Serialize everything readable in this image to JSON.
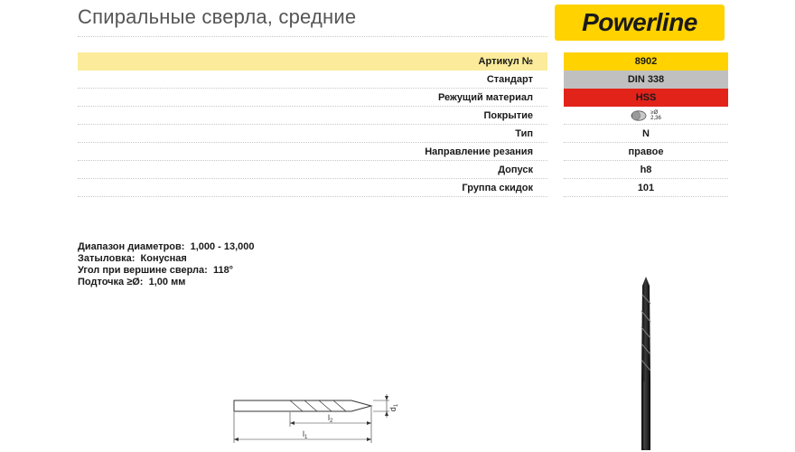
{
  "header": {
    "title": "Спиральные сверла, средние",
    "brand": "Powerline",
    "brand_color": "#ffd200"
  },
  "spec_table": [
    {
      "label": "Артикул №",
      "value": "8902",
      "color": "#ffd200"
    },
    {
      "label": "Стандарт",
      "value": "DIN 338",
      "color": "#c0c0c0"
    },
    {
      "label": "Режущий материал",
      "value": "HSS",
      "color": "#e2231a"
    },
    {
      "label": "Покрытие",
      "value": "",
      "coating_line1": "≥Ø",
      "coating_line2": "2,36"
    },
    {
      "label": "Тип",
      "value": "N"
    },
    {
      "label": "Направление резания",
      "value": "правое"
    },
    {
      "label": "Допуск",
      "value": "h8"
    },
    {
      "label": "Группа скидок",
      "value": "101"
    }
  ],
  "properties": [
    {
      "label": "Диапазон диаметров:",
      "value": "1,000 - 13,000"
    },
    {
      "label": "Затыловка:",
      "value": "Конусная"
    },
    {
      "label": "Угол при вершине сверла:",
      "value": "118°"
    },
    {
      "label": "Подточка ≥Ø:",
      "value": "1,00 мм"
    }
  ],
  "drawing": {
    "d1": "d",
    "d1_sub": "1",
    "l2": "l",
    "l2_sub": "2",
    "l1": "l",
    "l1_sub": "1"
  },
  "icons": {
    "logo": "powerline-logo",
    "coating": "coating-icon",
    "drill_photo": "drill-bit-image"
  }
}
